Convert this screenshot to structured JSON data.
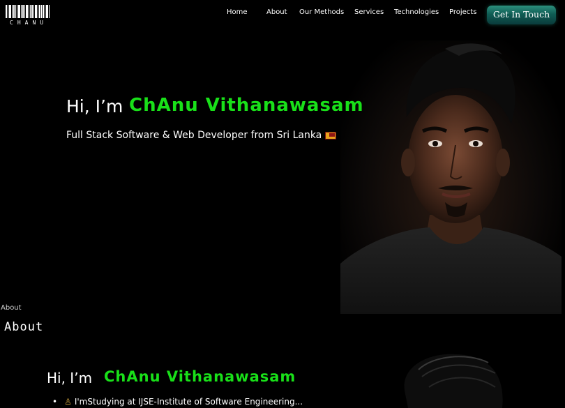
{
  "logo": {
    "text": "CHANU"
  },
  "nav": {
    "items": [
      {
        "label": "Home"
      },
      {
        "label": "About"
      },
      {
        "label": "Our Methods"
      },
      {
        "label": "Services"
      },
      {
        "label": "Technologies"
      },
      {
        "label": "Projects"
      }
    ],
    "cta_label": "Get In Touch"
  },
  "hero": {
    "greeting": "Hi, I’m",
    "name": "ChAnu Vithanawasam",
    "subtitle": "Full Stack Software & Web Developer from Sri Lanka",
    "flag_icon": "sri-lanka-flag-icon"
  },
  "about": {
    "small_label": "About",
    "title": "About",
    "greeting": "Hi, I’m",
    "name": "ChAnu Vithanawasam",
    "bullets": [
      {
        "icon": "student-icon",
        "text": "I'mStudying at IJSE-Institute of Software Engineering..."
      }
    ]
  },
  "colors": {
    "accent": "#19e019",
    "cta_gradient_top": "#2c8f7c",
    "cta_gradient_bottom": "#0a3b3b"
  }
}
